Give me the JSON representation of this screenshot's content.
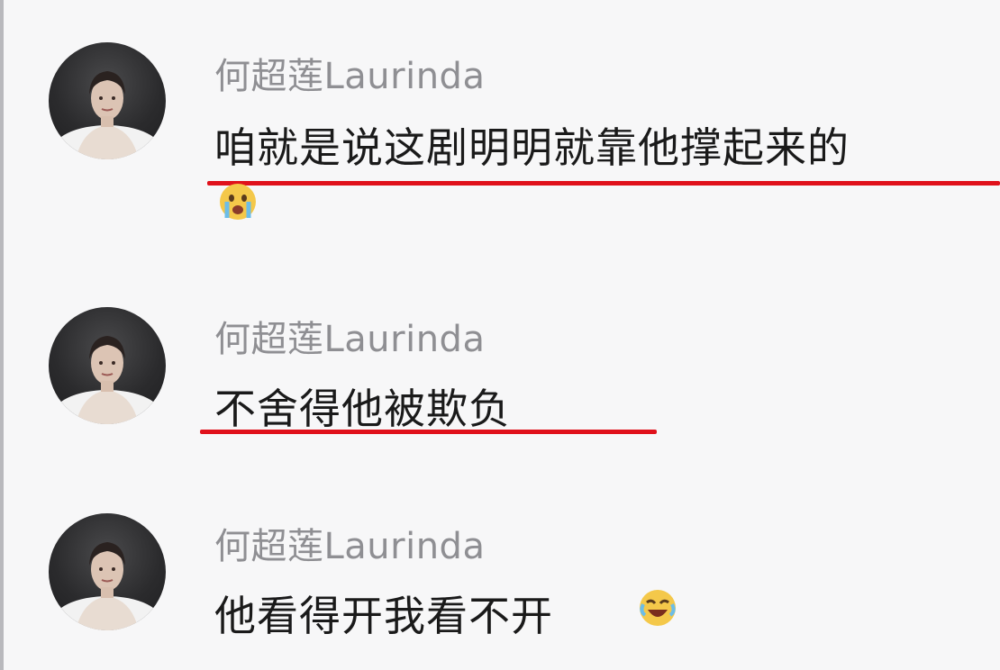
{
  "comments": [
    {
      "username": "何超莲Laurinda",
      "text": "咱就是说这剧明明就靠他撑起来的",
      "emoji": "crying-face-icon"
    },
    {
      "username": "何超莲Laurinda",
      "text": "不舍得他被欺负",
      "emoji": ""
    },
    {
      "username": "何超莲Laurinda",
      "text": "他看得开我看不开",
      "emoji": "laughing-tears-icon"
    }
  ],
  "colors": {
    "underline": "#e0111b",
    "username": "#8f8f93",
    "text": "#1a1a1a",
    "background": "#f7f7f8"
  }
}
